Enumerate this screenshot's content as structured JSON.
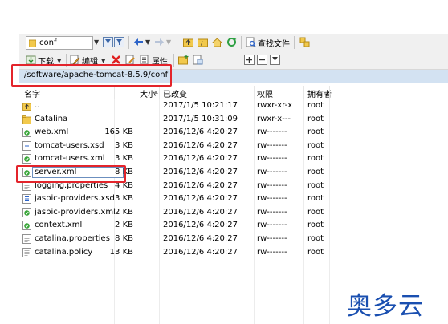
{
  "toolbar": {
    "folder_combo_value": "conf",
    "find_file_label": "查找文件",
    "download_label": "下载",
    "edit_label": "编辑",
    "properties_label": "属性"
  },
  "path": "/software/apache-tomcat-8.5.9/conf",
  "columns": {
    "name": "名字",
    "size": "大小",
    "modified": "已改变",
    "permissions": "权限",
    "owner": "拥有者"
  },
  "files": [
    {
      "name": "..",
      "size": "",
      "modified": "2017/1/5 10:21:17",
      "permissions": "rwxr-xr-x",
      "owner": "root",
      "icon": "parent-folder-icon"
    },
    {
      "name": "Catalina",
      "size": "",
      "modified": "2017/1/5 10:31:09",
      "permissions": "rwxr-x---",
      "owner": "root",
      "icon": "folder-icon"
    },
    {
      "name": "web.xml",
      "size": "165 KB",
      "modified": "2016/12/6 4:20:27",
      "permissions": "rw-------",
      "owner": "root",
      "icon": "xml-file-icon"
    },
    {
      "name": "tomcat-users.xsd",
      "size": "3 KB",
      "modified": "2016/12/6 4:20:27",
      "permissions": "rw-------",
      "owner": "root",
      "icon": "xsd-file-icon"
    },
    {
      "name": "tomcat-users.xml",
      "size": "3 KB",
      "modified": "2016/12/6 4:20:27",
      "permissions": "rw-------",
      "owner": "root",
      "icon": "xml-file-icon"
    },
    {
      "name": "server.xml",
      "size": "8 KB",
      "modified": "2016/12/6 4:20:27",
      "permissions": "rw-------",
      "owner": "root",
      "icon": "xml-file-icon"
    },
    {
      "name": "logging.properties",
      "size": "4 KB",
      "modified": "2016/12/6 4:20:27",
      "permissions": "rw-------",
      "owner": "root",
      "icon": "text-file-icon"
    },
    {
      "name": "jaspic-providers.xsd",
      "size": "3 KB",
      "modified": "2016/12/6 4:20:27",
      "permissions": "rw-------",
      "owner": "root",
      "icon": "xsd-file-icon"
    },
    {
      "name": "jaspic-providers.xml",
      "size": "2 KB",
      "modified": "2016/12/6 4:20:27",
      "permissions": "rw-------",
      "owner": "root",
      "icon": "xml-file-icon"
    },
    {
      "name": "context.xml",
      "size": "2 KB",
      "modified": "2016/12/6 4:20:27",
      "permissions": "rw-------",
      "owner": "root",
      "icon": "xml-file-icon"
    },
    {
      "name": "catalina.properties",
      "size": "8 KB",
      "modified": "2016/12/6 4:20:27",
      "permissions": "rw-------",
      "owner": "root",
      "icon": "text-file-icon"
    },
    {
      "name": "catalina.policy",
      "size": "13 KB",
      "modified": "2016/12/6 4:20:27",
      "permissions": "rw-------",
      "owner": "root",
      "icon": "text-file-icon"
    }
  ],
  "watermark": "奥多云",
  "colors": {
    "path_bar": "#d3e2f2",
    "highlight_red": "#e3242b",
    "folder_yellow": "#f2c94c",
    "watermark_blue": "#1a4fb0"
  }
}
